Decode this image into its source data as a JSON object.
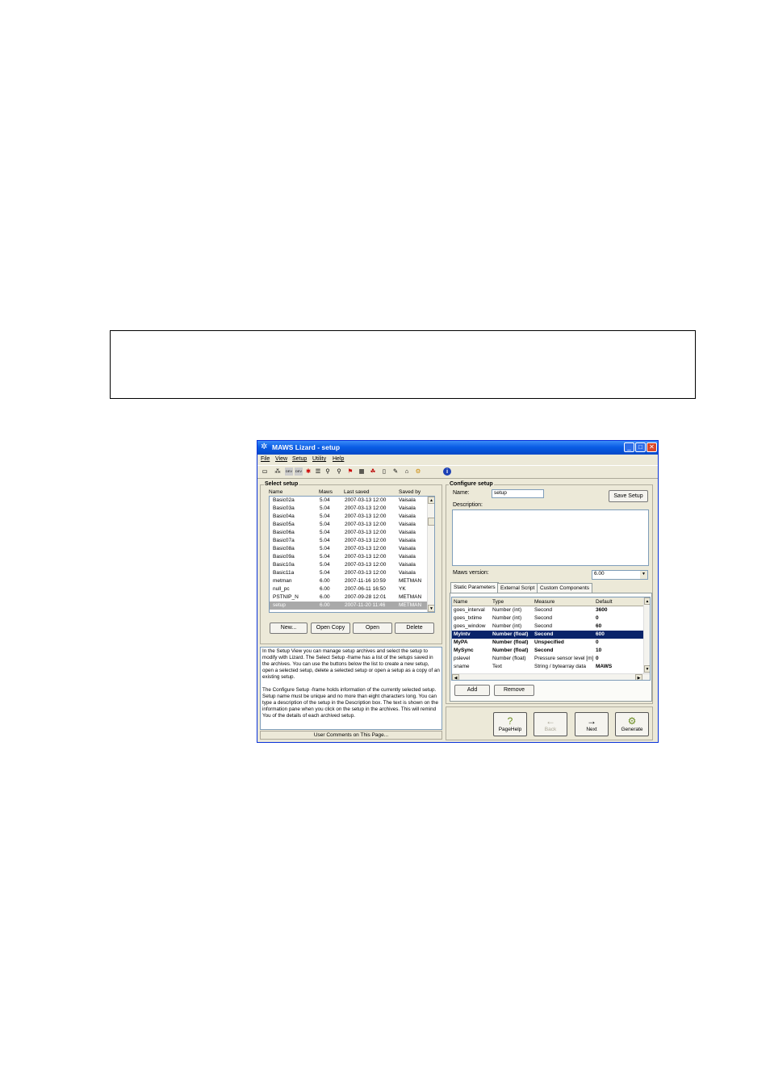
{
  "window": {
    "title": "MAWS Lizard - setup"
  },
  "menu": [
    "File",
    "View",
    "Setup",
    "Utility",
    "Help"
  ],
  "toolbar_icons": [
    "open-icon",
    "network-icon",
    "dev-icon",
    "dev2-icon",
    "star-icon",
    "list-icon",
    "figure-icon",
    "figure2-icon",
    "flag-icon",
    "grid-icon",
    "cluster-icon",
    "page-icon",
    "pen-icon",
    "bell-icon",
    "gear-icon",
    "info-icon"
  ],
  "select_setup": {
    "title": "Select setup",
    "headers": {
      "name": "Name",
      "maws": "Maws",
      "last_saved": "Last saved",
      "saved_by": "Saved by"
    },
    "rows": [
      {
        "name": "Basic02a",
        "maws": "5.04",
        "saved": "2007-03-13 12:00",
        "by": "Vaisala"
      },
      {
        "name": "Basic03a",
        "maws": "5.04",
        "saved": "2007-03-13 12:00",
        "by": "Vaisala"
      },
      {
        "name": "Basic04a",
        "maws": "5.04",
        "saved": "2007-03-13 12:00",
        "by": "Vaisala"
      },
      {
        "name": "Basic05a",
        "maws": "5.04",
        "saved": "2007-03-13 12:00",
        "by": "Vaisala"
      },
      {
        "name": "Basic06a",
        "maws": "5.04",
        "saved": "2007-03-13 12:00",
        "by": "Vaisala"
      },
      {
        "name": "Basic07a",
        "maws": "5.04",
        "saved": "2007-03-13 12:00",
        "by": "Vaisala"
      },
      {
        "name": "Basic08a",
        "maws": "5.04",
        "saved": "2007-03-13 12:00",
        "by": "Vaisala"
      },
      {
        "name": "Basic09a",
        "maws": "5.04",
        "saved": "2007-03-13 12:00",
        "by": "Vaisala"
      },
      {
        "name": "Basic10a",
        "maws": "5.04",
        "saved": "2007-03-13 12:00",
        "by": "Vaisala"
      },
      {
        "name": "Basic11a",
        "maws": "5.04",
        "saved": "2007-03-13 12:00",
        "by": "Vaisala"
      },
      {
        "name": "metman",
        "maws": "6.00",
        "saved": "2007-11-16 10:59",
        "by": "METMAN"
      },
      {
        "name": "null_pc",
        "maws": "6.00",
        "saved": "2007-06-11 16:50",
        "by": "YK"
      },
      {
        "name": "PSTNIP_N",
        "maws": "6.00",
        "saved": "2007-09-28 12:01",
        "by": "METMAN"
      },
      {
        "name": "setup",
        "maws": "6.00",
        "saved": "2007-11-20 11:46",
        "by": "METMAN"
      }
    ],
    "selected_row": 13,
    "buttons": {
      "new": "New...",
      "open_copy": "Open Copy",
      "open": "Open",
      "delete": "Delete"
    }
  },
  "info_text": [
    "In the Setup View you can manage setup archives and select the setup to modify with Lizard. The Select Setup -frame has a list of the setups saved in the archives. You can use the buttons below the list to create a new setup, open a selected setup, delete a selected setup or open a setup as a copy of an existing setup.",
    "The Configure Setup -frame holds information of the currently selected setup. Setup name must be unique and no more than eight characters long. You can type a description of the setup in the Description box. The text is shown on the information pane when you click on the setup in the archives. This will remind You of the details of each archived setup."
  ],
  "status_bar": "User Comments on This Page...",
  "configure_setup": {
    "title": "Configure setup",
    "name_label": "Name:",
    "name_value": "setup",
    "save_button": "Save Setup",
    "description_label": "Description:",
    "description_value": "",
    "maws_version_label": "Maws version:",
    "maws_version_value": "6.00",
    "tabs": [
      "Static Parameters",
      "External Script",
      "Custom Components"
    ],
    "active_tab": 0,
    "param_headers": {
      "name": "Name",
      "type": "Type",
      "measure": "Measure",
      "default": "Default"
    },
    "params": [
      {
        "name": "goes_interval",
        "type": "Number (int)",
        "measure": "Second",
        "default": "3600"
      },
      {
        "name": "goes_txtime",
        "type": "Number (int)",
        "measure": "Second",
        "default": "0"
      },
      {
        "name": "goes_window",
        "type": "Number (int)",
        "measure": "Second",
        "default": "60"
      },
      {
        "name": "MyIntv",
        "type": "Number (float)",
        "measure": "Second",
        "default": "600"
      },
      {
        "name": "MyPA",
        "type": "Number (float)",
        "measure": "Unspecified",
        "default": "0"
      },
      {
        "name": "MySync",
        "type": "Number (float)",
        "measure": "Second",
        "default": "10"
      },
      {
        "name": "pslevel",
        "type": "Number (float)",
        "measure": "Pressure sensor level [m]",
        "default": "0"
      },
      {
        "name": "sname",
        "type": "Text",
        "measure": "String / bytearray data",
        "default": "MAWS"
      }
    ],
    "highlighted_param": 3,
    "add_button": "Add",
    "remove_button": "Remove"
  },
  "nav_buttons": {
    "pagehelp": "PageHelp",
    "back": "Back",
    "next": "Next",
    "generate": "Generate"
  }
}
